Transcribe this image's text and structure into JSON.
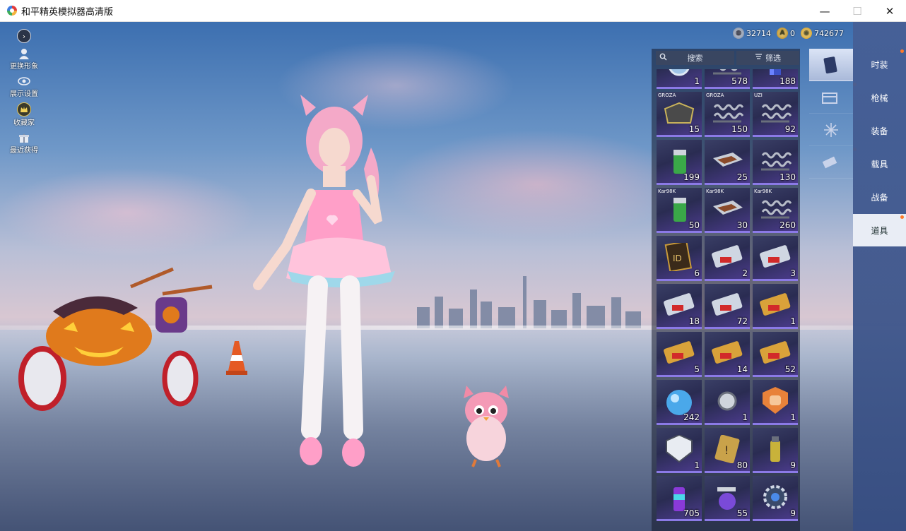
{
  "window": {
    "title": "和平精英模拟器高清版",
    "minimize": "—",
    "maximize": "☐",
    "close": "✕"
  },
  "left_menu": [
    {
      "label": "",
      "icon": "arrow-right-icon"
    },
    {
      "label": "更换形象",
      "icon": "person-icon"
    },
    {
      "label": "展示设置",
      "icon": "eye-icon"
    },
    {
      "label": "收藏家",
      "icon": "crown-badge-icon"
    },
    {
      "label": "最近获得",
      "icon": "gift-icon"
    }
  ],
  "currency": {
    "silver": "32714",
    "ag": "0",
    "gold": "742677"
  },
  "toolbar": {
    "search": "搜索",
    "filter": "筛选"
  },
  "items": [
    {
      "tag": "",
      "qty": "1",
      "icon": "scope"
    },
    {
      "tag": "",
      "qty": "578",
      "icon": "spring"
    },
    {
      "tag": "",
      "qty": "188",
      "icon": "cylinder"
    },
    {
      "tag": "GROZA",
      "qty": "15",
      "icon": "box"
    },
    {
      "tag": "GROZA",
      "qty": "150",
      "icon": "spring"
    },
    {
      "tag": "UZI",
      "qty": "92",
      "icon": "spring"
    },
    {
      "tag": "",
      "qty": "199",
      "icon": "can"
    },
    {
      "tag": "",
      "qty": "25",
      "icon": "tray"
    },
    {
      "tag": "",
      "qty": "130",
      "icon": "spring"
    },
    {
      "tag": "Kar98K",
      "qty": "50",
      "icon": "can"
    },
    {
      "tag": "Kar98K",
      "qty": "30",
      "icon": "tray"
    },
    {
      "tag": "Kar98K",
      "qty": "260",
      "icon": "spring"
    },
    {
      "tag": "",
      "qty": "6",
      "icon": "idcard"
    },
    {
      "tag": "",
      "qty": "2",
      "icon": "ticket-red"
    },
    {
      "tag": "",
      "qty": "3",
      "icon": "ticket-red"
    },
    {
      "tag": "",
      "qty": "18",
      "icon": "ticket-red"
    },
    {
      "tag": "",
      "qty": "72",
      "icon": "ticket-red"
    },
    {
      "tag": "",
      "qty": "1",
      "icon": "ticket-gold"
    },
    {
      "tag": "",
      "qty": "5",
      "icon": "ticket-gold"
    },
    {
      "tag": "",
      "qty": "14",
      "icon": "ticket-gold"
    },
    {
      "tag": "",
      "qty": "52",
      "icon": "ticket-gold"
    },
    {
      "tag": "",
      "qty": "242",
      "icon": "orb"
    },
    {
      "tag": "",
      "qty": "1",
      "icon": "medal"
    },
    {
      "tag": "",
      "qty": "1",
      "icon": "fist"
    },
    {
      "tag": "",
      "qty": "1",
      "icon": "badge-silver"
    },
    {
      "tag": "",
      "qty": "80",
      "icon": "card-gold"
    },
    {
      "tag": "",
      "qty": "9",
      "icon": "grenade"
    },
    {
      "tag": "",
      "qty": "705",
      "icon": "spraycan"
    },
    {
      "tag": "",
      "qty": "55",
      "icon": "spraygun"
    },
    {
      "tag": "",
      "qty": "9",
      "icon": "gear"
    }
  ],
  "side_tabs": [
    {
      "icon": "card-icon"
    },
    {
      "icon": "calendar-icon"
    },
    {
      "icon": "spark-icon"
    },
    {
      "icon": "ticket-icon"
    }
  ],
  "categories": [
    "时装",
    "枪械",
    "装备",
    "载具",
    "战备",
    "道具"
  ],
  "active_category": 5,
  "colors": {
    "panel_accent": "#8b7ae6",
    "category_bar": "#4a66a0",
    "badge_dot": "#ff7a2a"
  }
}
